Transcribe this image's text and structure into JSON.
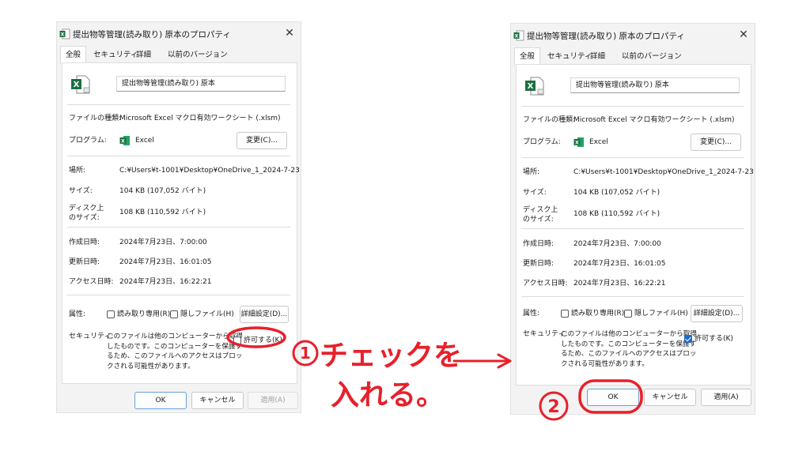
{
  "dialog": {
    "title": "提出物等管理(読み取り) 原本のプロパティ",
    "close_glyph": "✕",
    "tabs": [
      "全般",
      "セキュリティ",
      "詳細",
      "以前のバージョン"
    ],
    "file_name": "提出物等管理(読み取り) 原本",
    "rows": {
      "file_type_label": "ファイルの種類:",
      "file_type_value": "Microsoft Excel マクロ有効ワークシート (.xlsm)",
      "program_label": "プログラム:",
      "program_value": "Excel",
      "change_button": "変更(C)...",
      "location_label": "場所:",
      "location_value": "C:¥Users¥t-1001¥Desktop¥OneDrive_1_2024-7-23",
      "size_label": "サイズ:",
      "size_value": "104 KB (107,052 バイト)",
      "disk_size_label_1": "ディスク上",
      "disk_size_label_2": "のサイズ:",
      "disk_size_value": "108 KB (110,592 バイト)",
      "created_label": "作成日時:",
      "created_value": "2024年7月23日、7:00:00",
      "modified_label": "更新日時:",
      "modified_value": "2024年7月23日、16:01:05",
      "accessed_label": "アクセス日時:",
      "accessed_value": "2024年7月23日、16:22:21",
      "attributes_label": "属性:",
      "readonly_label": "読み取り専用(R)",
      "hidden_label": "隠しファイル(H)",
      "advanced_button": "詳細設定(D)...",
      "security_label": "セキュリティ:",
      "security_lines": [
        "このファイルは他のコンピューターから取得",
        "したものです。このコンピューターを保護す",
        "るため、このファイルへのアクセスはブロッ",
        "クされる可能性があります。"
      ],
      "allow_label": "許可する(K)"
    },
    "buttons": {
      "ok": "OK",
      "cancel": "キャンセル",
      "apply": "適用(A)"
    }
  },
  "left_state": {
    "allow_checked": false
  },
  "right_state": {
    "allow_checked": true
  },
  "annotations": {
    "step1_number": "1",
    "step1_line1": "チェックを",
    "step1_line2": "入れる。",
    "step2_number": "2",
    "arrow": "arrow-right",
    "color": "#e8202a"
  },
  "colors": {
    "excel_green": "#1d7044",
    "accent_blue": "#1f6cc5"
  }
}
